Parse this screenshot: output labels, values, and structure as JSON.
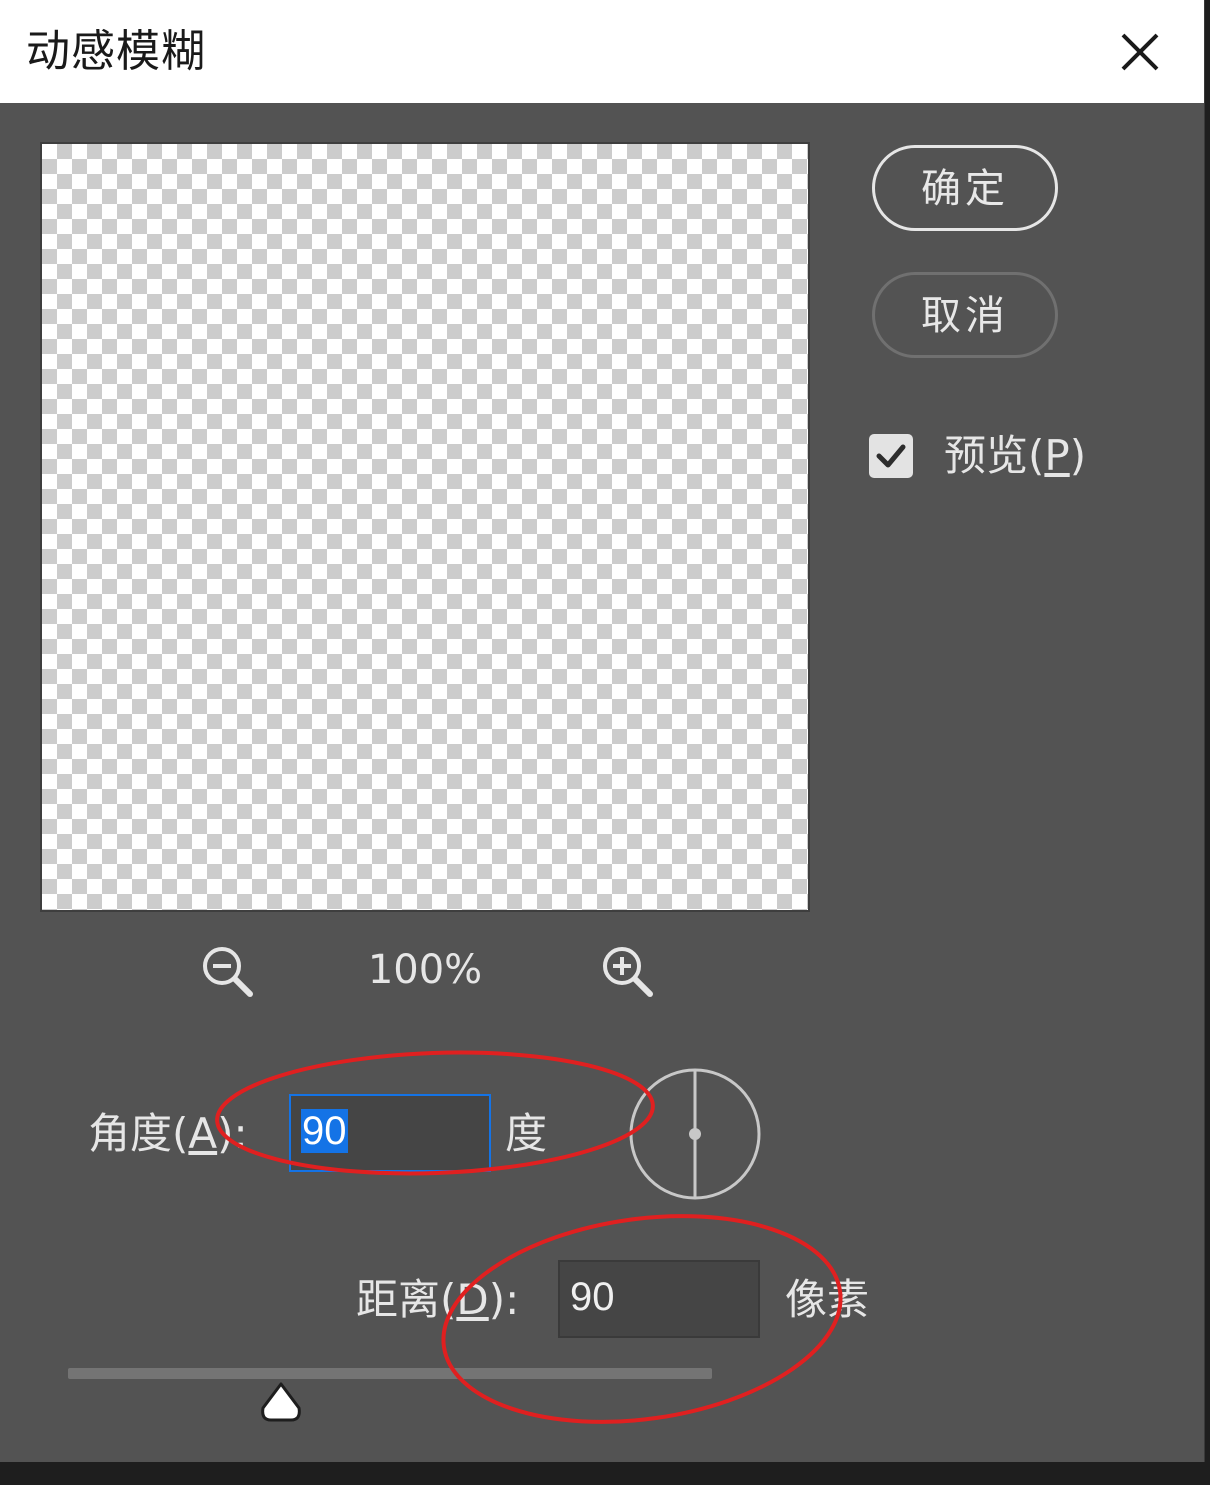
{
  "dialog": {
    "title": "动感模糊"
  },
  "buttons": {
    "ok": "确定",
    "cancel": "取消"
  },
  "preview_option": {
    "label": "预览(",
    "mnemonic": "P",
    "label_end": ")",
    "checked": true
  },
  "zoom": {
    "level": "100%"
  },
  "angle": {
    "label": "角度(",
    "mnemonic": "A",
    "label_end": "):",
    "value": "90",
    "unit": "度"
  },
  "distance": {
    "label": "距离(",
    "mnemonic": "D",
    "label_end": "):",
    "value": "90",
    "unit": "像素",
    "slider_fraction": 0.33
  },
  "colors": {
    "panel": "#535353",
    "accent": "#1473e6",
    "annotation": "#e02020"
  }
}
